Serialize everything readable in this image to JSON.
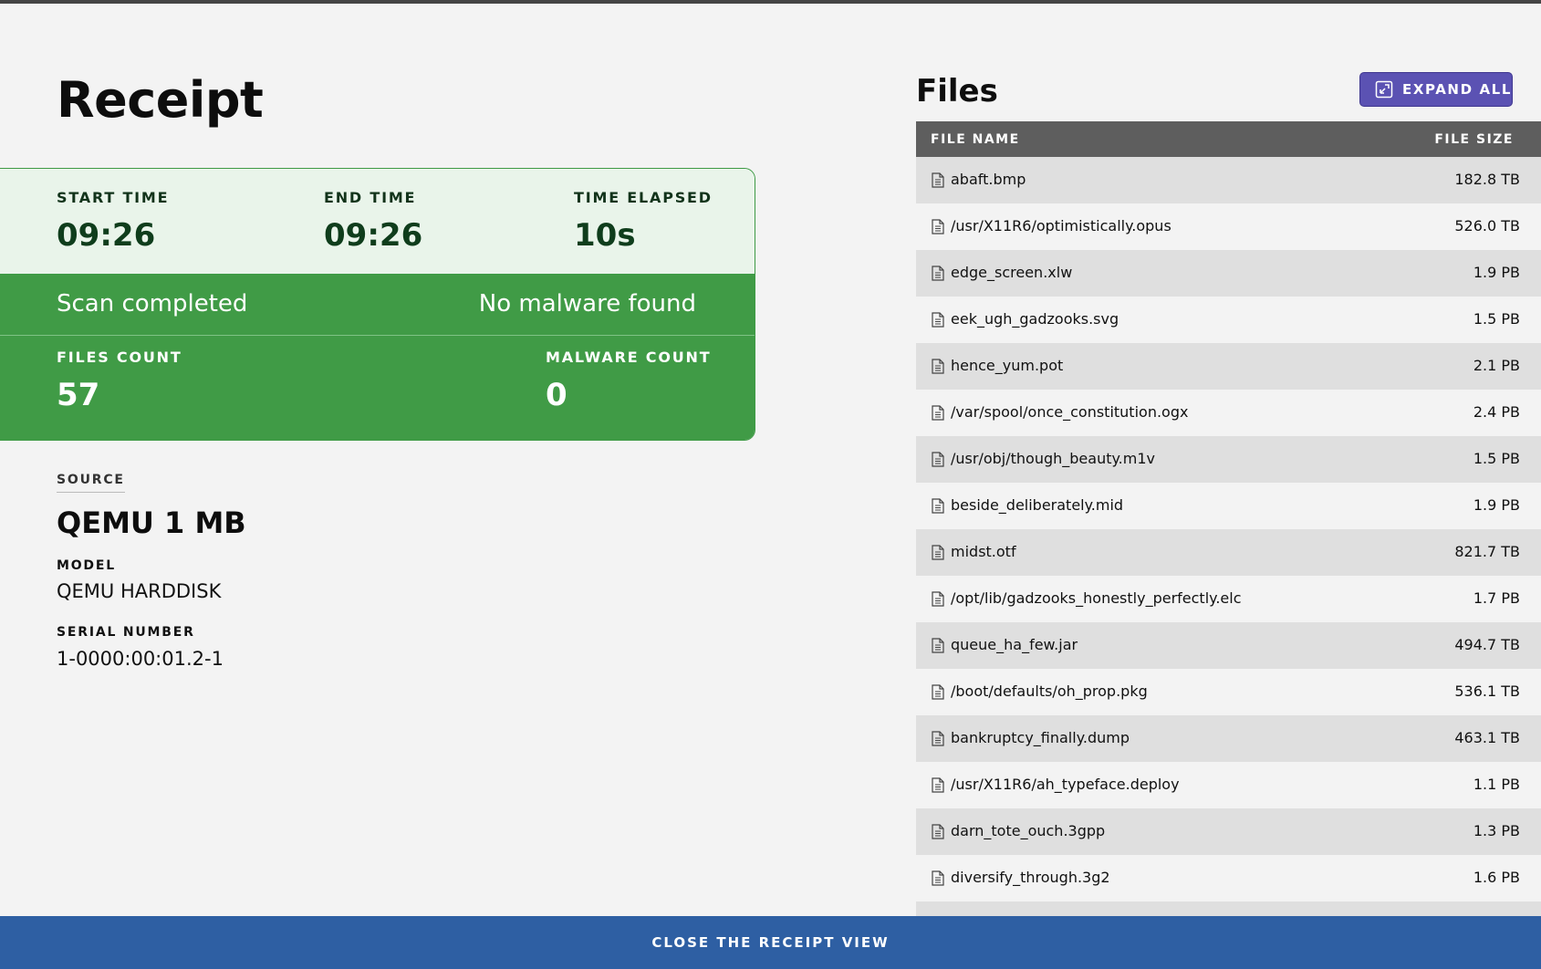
{
  "receipt": {
    "title": "Receipt",
    "start_time_label": "START TIME",
    "start_time": "09:26",
    "end_time_label": "END TIME",
    "end_time": "09:26",
    "elapsed_label": "TIME ELAPSED",
    "elapsed": "10s",
    "status_text": "Scan completed",
    "result_text": "No malware found",
    "files_count_label": "FILES COUNT",
    "files_count": "57",
    "malware_count_label": "MALWARE COUNT",
    "malware_count": "0",
    "status_color": "#409b46"
  },
  "source": {
    "label": "SOURCE",
    "name": "QEMU 1 MB",
    "model_label": "MODEL",
    "model": "QEMU HARDDISK",
    "serial_label": "SERIAL NUMBER",
    "serial": "1-0000:00:01.2-1"
  },
  "files": {
    "title": "Files",
    "expand_label": "EXPAND ALL",
    "col_name": "FILE NAME",
    "col_size": "FILE SIZE",
    "rows": [
      {
        "name": "abaft.bmp",
        "size": "182.8 TB"
      },
      {
        "name": "/usr/X11R6/optimistically.opus",
        "size": "526.0 TB"
      },
      {
        "name": "edge_screen.xlw",
        "size": "1.9 PB"
      },
      {
        "name": "eek_ugh_gadzooks.svg",
        "size": "1.5 PB"
      },
      {
        "name": "hence_yum.pot",
        "size": "2.1 PB"
      },
      {
        "name": "/var/spool/once_constitution.ogx",
        "size": "2.4 PB"
      },
      {
        "name": "/usr/obj/though_beauty.m1v",
        "size": "1.5 PB"
      },
      {
        "name": "beside_deliberately.mid",
        "size": "1.9 PB"
      },
      {
        "name": "midst.otf",
        "size": "821.7 TB"
      },
      {
        "name": "/opt/lib/gadzooks_honestly_perfectly.elc",
        "size": "1.7 PB"
      },
      {
        "name": "queue_ha_few.jar",
        "size": "494.7 TB"
      },
      {
        "name": "/boot/defaults/oh_prop.pkg",
        "size": "536.1 TB"
      },
      {
        "name": "bankruptcy_finally.dump",
        "size": "463.1 TB"
      },
      {
        "name": "/usr/X11R6/ah_typeface.deploy",
        "size": "1.1 PB"
      },
      {
        "name": "darn_tote_ouch.3gpp",
        "size": "1.3 PB"
      },
      {
        "name": "diversify_through.3g2",
        "size": "1.6 PB"
      },
      {
        "name": "",
        "size": ""
      }
    ]
  },
  "footer": {
    "close_label": "CLOSE THE RECEIPT VIEW"
  }
}
